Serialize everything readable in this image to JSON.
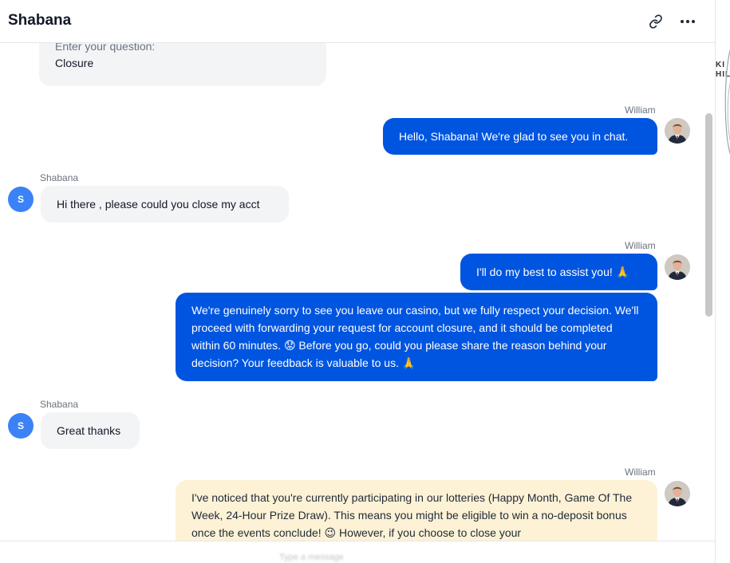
{
  "header": {
    "title": "Shabana",
    "link_icon": "link-icon",
    "more_icon": "more-horizontal-icon"
  },
  "form": {
    "prompt": "Enter your question:",
    "answer": "Closure"
  },
  "messages": [
    {
      "sender": "William",
      "role": "agent",
      "text": "Hello, Shabana! We're glad to see you in chat."
    },
    {
      "sender": "Shabana",
      "role": "user",
      "avatar_letter": "S",
      "text": "Hi there , please could you close my acct"
    },
    {
      "sender": "William",
      "role": "agent",
      "text": "I'll do my best to assist you! 🙏"
    },
    {
      "sender": "",
      "role": "agent",
      "text": "We're genuinely sorry to see you leave our casino, but we fully respect your decision. We'll proceed with forwarding your request for account closure, and it should be completed within 60 minutes. 😟 Before you go, could you please share the reason behind your decision? Your feedback is valuable to us. 🙏"
    },
    {
      "sender": "Shabana",
      "role": "user",
      "avatar_letter": "S",
      "text": "Great thanks"
    },
    {
      "sender": "William",
      "role": "agent",
      "text": "I've noticed that you're currently participating in our lotteries (Happy Month, Game Of The Week, 24-Hour Prize Draw). This means you might be eligible to win a no-deposit bonus once the events conclude! 😉 However, if you choose to close your"
    }
  ],
  "footer": {
    "hint": "Type a message"
  },
  "side_fragment": "KI\nHIL",
  "colors": {
    "agent_bubble": "#0055e0",
    "user_bubble": "#f3f4f6",
    "promo_bubble": "#fdf2d6",
    "user_avatar": "#3b82f6"
  }
}
